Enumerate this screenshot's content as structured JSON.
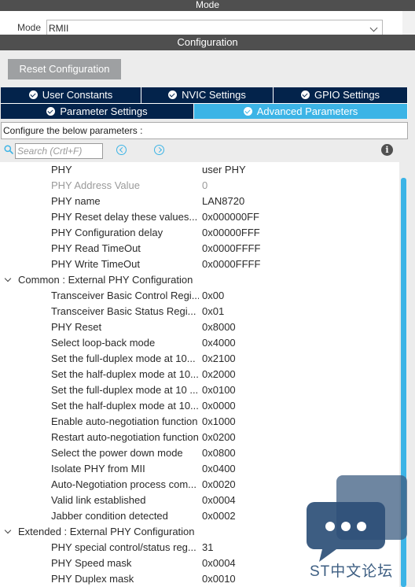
{
  "mode_panel": {
    "title": "Mode",
    "mode_label": "Mode",
    "mode_value": "RMII"
  },
  "config_panel": {
    "title": "Configuration",
    "reset_button": "Reset Configuration"
  },
  "tabs": {
    "user_constants": "User Constants",
    "nvic_settings": "NVIC Settings",
    "gpio_settings": "GPIO Settings",
    "parameter_settings": "Parameter Settings",
    "advanced_parameters": "Advanced Parameters"
  },
  "active_tab": "Advanced Parameters",
  "hint": "Configure the below parameters :",
  "search": {
    "placeholder": "Search (Crtl+F)"
  },
  "icons": {
    "search": "search-icon",
    "previous": "chevron-left-circle-icon",
    "next": "chevron-right-circle-icon",
    "info": "info-icon"
  },
  "colors": {
    "header_bg": "#4f4f4f",
    "tab_dark": "#03234b",
    "tab_active": "#3cb4e6",
    "reset_button_bg": "#9ea0a2",
    "watermark": "#3d5e82"
  },
  "rows": [
    {
      "name": "PHY",
      "value": "user PHY"
    },
    {
      "name": "PHY Address Value",
      "value": "0",
      "disabled": true
    },
    {
      "name": "PHY name",
      "value": "LAN8720"
    },
    {
      "name": "PHY Reset delay these values...",
      "value": "0x000000FF"
    },
    {
      "name": "PHY Configuration delay",
      "value": "0x00000FFF"
    },
    {
      "name": "PHY Read TimeOut",
      "value": "0x0000FFFF"
    },
    {
      "name": "PHY Write TimeOut",
      "value": "0x0000FFFF"
    },
    {
      "name": "Common : External PHY Configuration",
      "group": true
    },
    {
      "name": "Transceiver Basic Control Regi...",
      "value": "0x00"
    },
    {
      "name": "Transceiver Basic Status Regi...",
      "value": "0x01"
    },
    {
      "name": "PHY Reset",
      "value": "0x8000"
    },
    {
      "name": "Select loop-back mode",
      "value": "0x4000"
    },
    {
      "name": "Set the full-duplex mode at 10...",
      "value": "0x2100"
    },
    {
      "name": "Set the half-duplex mode at 10...",
      "value": "0x2000"
    },
    {
      "name": "Set the full-duplex mode at 10 ...",
      "value": "0x0100"
    },
    {
      "name": "Set the half-duplex mode at 10...",
      "value": "0x0000"
    },
    {
      "name": "Enable auto-negotiation function",
      "value": "0x1000"
    },
    {
      "name": "Restart auto-negotiation function",
      "value": "0x0200"
    },
    {
      "name": "Select the power down mode",
      "value": "0x0800"
    },
    {
      "name": "Isolate PHY from MII",
      "value": "0x0400"
    },
    {
      "name": "Auto-Negotiation process com...",
      "value": "0x0020"
    },
    {
      "name": "Valid link established",
      "value": "0x0004"
    },
    {
      "name": "Jabber condition detected",
      "value": "0x0002"
    },
    {
      "name": "Extended : External PHY Configuration",
      "group": true
    },
    {
      "name": "PHY special control/status reg...",
      "value": "31"
    },
    {
      "name": "PHY Speed mask",
      "value": "0x0004"
    },
    {
      "name": "PHY Duplex mask",
      "value": "0x0010"
    }
  ],
  "watermark": {
    "text": "ST中文论坛"
  }
}
